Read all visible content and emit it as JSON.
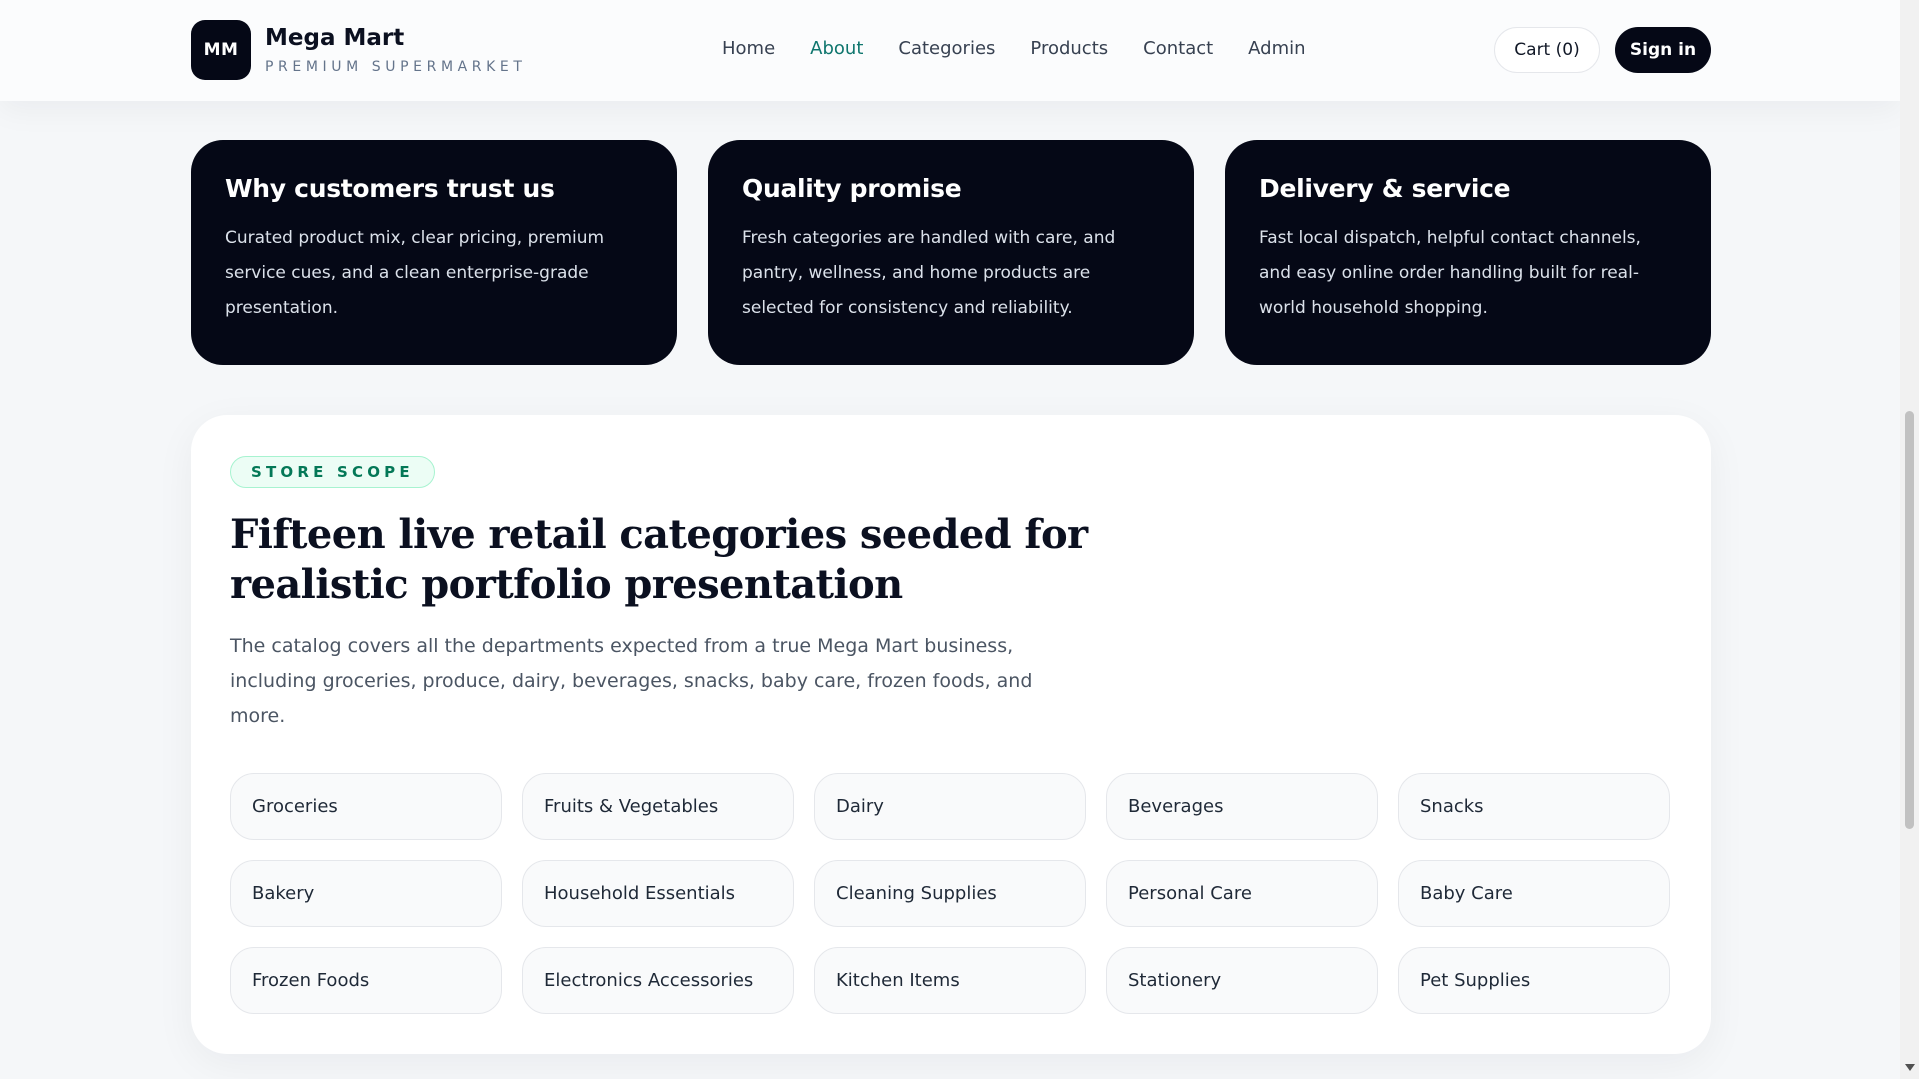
{
  "brand": {
    "logo_initials": "MM",
    "name": "Mega Mart",
    "tagline": "PREMIUM SUPERMARKET"
  },
  "nav": {
    "items": [
      {
        "label": "Home",
        "active": false
      },
      {
        "label": "About",
        "active": true
      },
      {
        "label": "Categories",
        "active": false
      },
      {
        "label": "Products",
        "active": false
      },
      {
        "label": "Contact",
        "active": false
      },
      {
        "label": "Admin",
        "active": false
      }
    ]
  },
  "header_actions": {
    "cart_label": "Cart (0)",
    "signin_label": "Sign in"
  },
  "cards": [
    {
      "title": "Why customers trust us",
      "body": "Curated product mix, clear pricing, premium service cues, and a clean enterprise-grade presentation."
    },
    {
      "title": "Quality promise",
      "body": "Fresh categories are handled with care, and pantry, wellness, and home products are selected for consistency and reliability."
    },
    {
      "title": "Delivery & service",
      "body": "Fast local dispatch, helpful contact channels, and easy online order handling built for real-world household shopping."
    }
  ],
  "scope": {
    "eyebrow": "STORE SCOPE",
    "heading": "Fifteen live retail categories seeded for realistic portfolio presentation",
    "lead": "The catalog covers all the departments expected from a true Mega Mart business, including groceries, produce, dairy, beverages, snacks, baby care, frozen foods, and more.",
    "categories": [
      "Groceries",
      "Fruits & Vegetables",
      "Dairy",
      "Beverages",
      "Snacks",
      "Bakery",
      "Household Essentials",
      "Cleaning Supplies",
      "Personal Care",
      "Baby Care",
      "Frozen Foods",
      "Electronics Accessories",
      "Kitchen Items",
      "Stationery",
      "Pet Supplies"
    ]
  },
  "colors": {
    "accent": "#0f766e",
    "dark": "#050816",
    "eyebrow_text": "#047857",
    "eyebrow_bg": "#ecfdf5"
  }
}
